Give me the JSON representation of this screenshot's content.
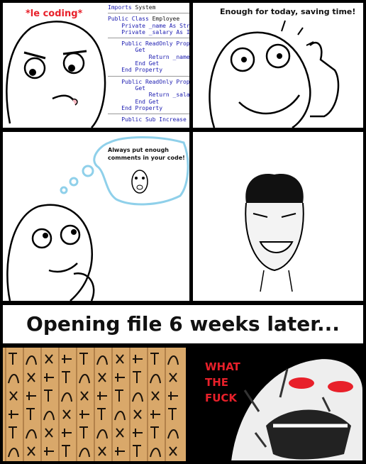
{
  "panel1": {
    "caption": "*le coding*",
    "caption_color": "#e8202a",
    "code_lines": [
      [
        "Imports",
        " System"
      ],
      null,
      [
        "Public Class",
        " Employee"
      ],
      [
        "    Private _name As Str",
        ""
      ],
      [
        "    Private _salary As I",
        ""
      ],
      null,
      [
        "    Public ReadOnly Prop",
        ""
      ],
      [
        "        Get",
        ""
      ],
      [
        "            Return _name",
        ""
      ],
      [
        "        End Get",
        ""
      ],
      [
        "    End Property",
        ""
      ],
      null,
      [
        "    Public ReadOnly Prop",
        ""
      ],
      [
        "        Get",
        ""
      ],
      [
        "            Return _sala",
        ""
      ],
      [
        "        End Get",
        ""
      ],
      [
        "    End Property",
        ""
      ],
      null,
      [
        "    Public Sub Increase",
        ""
      ]
    ]
  },
  "panel2": {
    "caption": "Enough for today, saving time!"
  },
  "panel3": {
    "thought": "Always put enough comments in your code!"
  },
  "banner": {
    "text": "Opening file 6 weeks later..."
  },
  "panel6": {
    "words": [
      "WHAT",
      "THE",
      "FUCK"
    ],
    "text_color": "#e8202a"
  }
}
